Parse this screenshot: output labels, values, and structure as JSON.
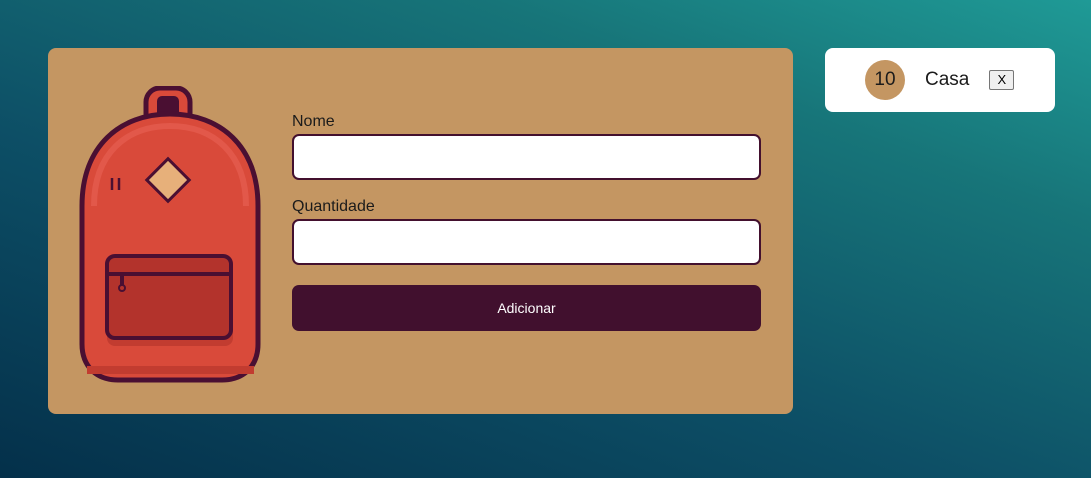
{
  "form": {
    "name_label": "Nome",
    "name_value": "",
    "quantity_label": "Quantidade",
    "quantity_value": "",
    "submit_label": "Adicionar"
  },
  "items": [
    {
      "quantity": "10",
      "name": "Casa",
      "remove_label": "X"
    }
  ],
  "colors": {
    "card_background": "#c49662",
    "button": "#41102e",
    "input_border": "#43102e",
    "backpack_body": "#d94a3a",
    "backpack_outline": "#4a0f32"
  },
  "icons": {
    "illustration": "backpack-icon"
  }
}
